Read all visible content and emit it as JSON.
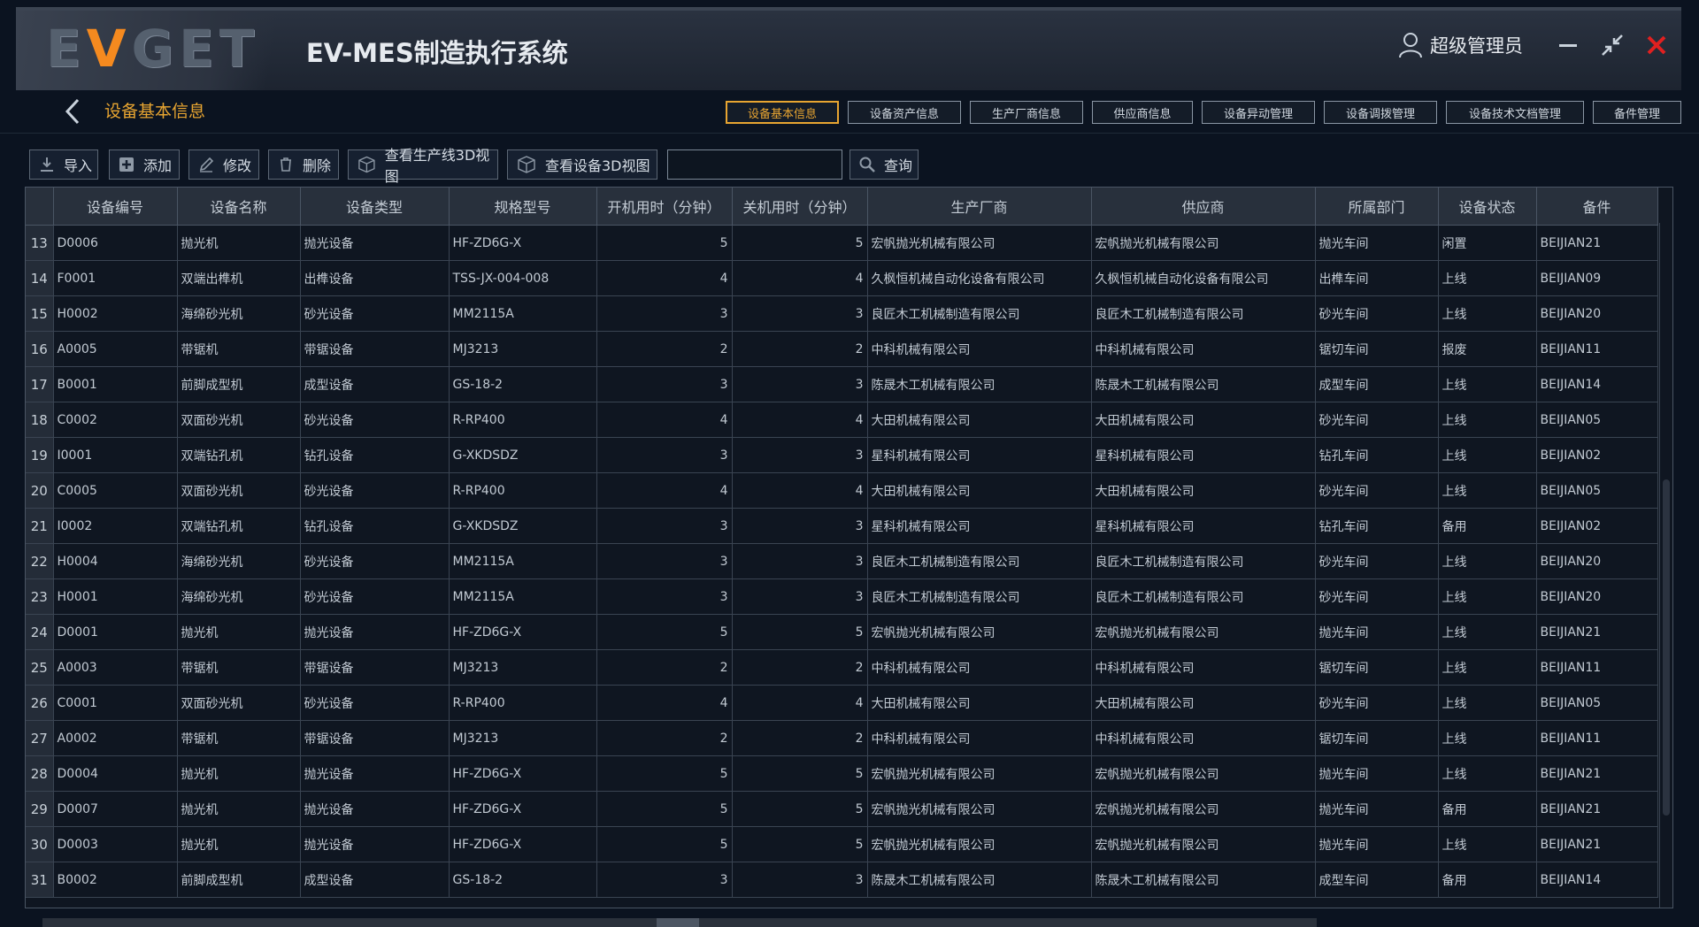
{
  "header": {
    "logo_text_pre": "E",
    "logo_text_accent": "V",
    "logo_text_post": "GET",
    "app_title": "EV-MES制造执行系统",
    "user_name": "超级管理员"
  },
  "nav": {
    "page_title": "设备基本信息",
    "tabs": [
      "设备基本信息",
      "设备资产信息",
      "生产厂商信息",
      "供应商信息",
      "设备异动管理",
      "设备调拨管理",
      "设备技术文档管理",
      "备件管理"
    ],
    "active_tab": "设备基本信息"
  },
  "toolbar": {
    "import": "导入",
    "add": "添加",
    "edit": "修改",
    "delete": "删除",
    "view_line_3d": "查看生产线3D视图",
    "view_device_3d": "查看设备3D视图",
    "search_value": "",
    "query": "查询"
  },
  "table": {
    "columns": [
      "设备编号",
      "设备名称",
      "设备类型",
      "规格型号",
      "开机用时（分钟）",
      "关机用时（分钟）",
      "生产厂商",
      "供应商",
      "所属部门",
      "设备状态",
      "备件"
    ],
    "rows": [
      {
        "idx": "13",
        "code": "D0006",
        "name": "抛光机",
        "type": "抛光设备",
        "spec": "HF-ZD6G-X",
        "on": "5",
        "off": "5",
        "maker": "宏帆抛光机械有限公司",
        "supplier": "宏帆抛光机械有限公司",
        "dept": "抛光车间",
        "status": "闲置",
        "part": "BEIJIAN21"
      },
      {
        "idx": "14",
        "code": "F0001",
        "name": "双端出榫机",
        "type": "出榫设备",
        "spec": "TSS-JX-004-008",
        "on": "4",
        "off": "4",
        "maker": "久枫恒机械自动化设备有限公司",
        "supplier": "久枫恒机械自动化设备有限公司",
        "dept": "出榫车间",
        "status": "上线",
        "part": "BEIJIAN09"
      },
      {
        "idx": "15",
        "code": "H0002",
        "name": "海绵砂光机",
        "type": "砂光设备",
        "spec": "MM2115A",
        "on": "3",
        "off": "3",
        "maker": "良匠木工机械制造有限公司",
        "supplier": "良匠木工机械制造有限公司",
        "dept": "砂光车间",
        "status": "上线",
        "part": "BEIJIAN20"
      },
      {
        "idx": "16",
        "code": "A0005",
        "name": "带锯机",
        "type": "带锯设备",
        "spec": "MJ3213",
        "on": "2",
        "off": "2",
        "maker": "中科机械有限公司",
        "supplier": "中科机械有限公司",
        "dept": "锯切车间",
        "status": "报废",
        "part": "BEIJIAN11"
      },
      {
        "idx": "17",
        "code": "B0001",
        "name": "前脚成型机",
        "type": "成型设备",
        "spec": "GS-18-2",
        "on": "3",
        "off": "3",
        "maker": "陈晟木工机械有限公司",
        "supplier": "陈晟木工机械有限公司",
        "dept": "成型车间",
        "status": "上线",
        "part": "BEIJIAN14"
      },
      {
        "idx": "18",
        "code": "C0002",
        "name": "双面砂光机",
        "type": "砂光设备",
        "spec": "R-RP400",
        "on": "4",
        "off": "4",
        "maker": "大田机械有限公司",
        "supplier": "大田机械有限公司",
        "dept": "砂光车间",
        "status": "上线",
        "part": "BEIJIAN05"
      },
      {
        "idx": "19",
        "code": "I0001",
        "name": "双端钻孔机",
        "type": "钻孔设备",
        "spec": "G-XKDSDZ",
        "on": "3",
        "off": "3",
        "maker": "星科机械有限公司",
        "supplier": "星科机械有限公司",
        "dept": "钻孔车间",
        "status": "上线",
        "part": "BEIJIAN02"
      },
      {
        "idx": "20",
        "code": "C0005",
        "name": "双面砂光机",
        "type": "砂光设备",
        "spec": "R-RP400",
        "on": "4",
        "off": "4",
        "maker": "大田机械有限公司",
        "supplier": "大田机械有限公司",
        "dept": "砂光车间",
        "status": "上线",
        "part": "BEIJIAN05"
      },
      {
        "idx": "21",
        "code": "I0002",
        "name": "双端钻孔机",
        "type": "钻孔设备",
        "spec": "G-XKDSDZ",
        "on": "3",
        "off": "3",
        "maker": "星科机械有限公司",
        "supplier": "星科机械有限公司",
        "dept": "钻孔车间",
        "status": "备用",
        "part": "BEIJIAN02"
      },
      {
        "idx": "22",
        "code": "H0004",
        "name": "海绵砂光机",
        "type": "砂光设备",
        "spec": "MM2115A",
        "on": "3",
        "off": "3",
        "maker": "良匠木工机械制造有限公司",
        "supplier": "良匠木工机械制造有限公司",
        "dept": "砂光车间",
        "status": "上线",
        "part": "BEIJIAN20"
      },
      {
        "idx": "23",
        "code": "H0001",
        "name": "海绵砂光机",
        "type": "砂光设备",
        "spec": "MM2115A",
        "on": "3",
        "off": "3",
        "maker": "良匠木工机械制造有限公司",
        "supplier": "良匠木工机械制造有限公司",
        "dept": "砂光车间",
        "status": "上线",
        "part": "BEIJIAN20"
      },
      {
        "idx": "24",
        "code": "D0001",
        "name": "抛光机",
        "type": "抛光设备",
        "spec": "HF-ZD6G-X",
        "on": "5",
        "off": "5",
        "maker": "宏帆抛光机械有限公司",
        "supplier": "宏帆抛光机械有限公司",
        "dept": "抛光车间",
        "status": "上线",
        "part": "BEIJIAN21"
      },
      {
        "idx": "25",
        "code": "A0003",
        "name": "带锯机",
        "type": "带锯设备",
        "spec": "MJ3213",
        "on": "2",
        "off": "2",
        "maker": "中科机械有限公司",
        "supplier": "中科机械有限公司",
        "dept": "锯切车间",
        "status": "上线",
        "part": "BEIJIAN11"
      },
      {
        "idx": "26",
        "code": "C0001",
        "name": "双面砂光机",
        "type": "砂光设备",
        "spec": "R-RP400",
        "on": "4",
        "off": "4",
        "maker": "大田机械有限公司",
        "supplier": "大田机械有限公司",
        "dept": "砂光车间",
        "status": "上线",
        "part": "BEIJIAN05"
      },
      {
        "idx": "27",
        "code": "A0002",
        "name": "带锯机",
        "type": "带锯设备",
        "spec": "MJ3213",
        "on": "2",
        "off": "2",
        "maker": "中科机械有限公司",
        "supplier": "中科机械有限公司",
        "dept": "锯切车间",
        "status": "上线",
        "part": "BEIJIAN11"
      },
      {
        "idx": "28",
        "code": "D0004",
        "name": "抛光机",
        "type": "抛光设备",
        "spec": "HF-ZD6G-X",
        "on": "5",
        "off": "5",
        "maker": "宏帆抛光机械有限公司",
        "supplier": "宏帆抛光机械有限公司",
        "dept": "抛光车间",
        "status": "上线",
        "part": "BEIJIAN21"
      },
      {
        "idx": "29",
        "code": "D0007",
        "name": "抛光机",
        "type": "抛光设备",
        "spec": "HF-ZD6G-X",
        "on": "5",
        "off": "5",
        "maker": "宏帆抛光机械有限公司",
        "supplier": "宏帆抛光机械有限公司",
        "dept": "抛光车间",
        "status": "备用",
        "part": "BEIJIAN21"
      },
      {
        "idx": "30",
        "code": "D0003",
        "name": "抛光机",
        "type": "抛光设备",
        "spec": "HF-ZD6G-X",
        "on": "5",
        "off": "5",
        "maker": "宏帆抛光机械有限公司",
        "supplier": "宏帆抛光机械有限公司",
        "dept": "抛光车间",
        "status": "上线",
        "part": "BEIJIAN21"
      },
      {
        "idx": "31",
        "code": "B0002",
        "name": "前脚成型机",
        "type": "成型设备",
        "spec": "GS-18-2",
        "on": "3",
        "off": "3",
        "maker": "陈晟木工机械有限公司",
        "supplier": "陈晟木工机械有限公司",
        "dept": "成型车间",
        "status": "备用",
        "part": "BEIJIAN14"
      }
    ]
  },
  "icons": {
    "user": "user-icon",
    "minimize": "minimize-icon",
    "restore": "restore-icon",
    "close": "close-icon",
    "back": "chevron-left-icon"
  },
  "colors": {
    "accent": "#e8a531",
    "logo_accent": "#f58a1f",
    "close": "#e02020",
    "background": "#0b1320"
  }
}
